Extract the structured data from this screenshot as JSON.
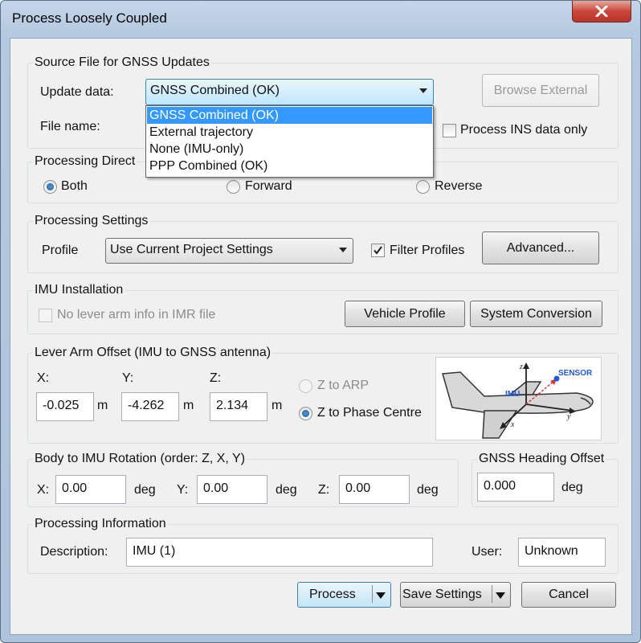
{
  "window": {
    "title": "Process Loosely Coupled"
  },
  "source_file": {
    "legend": "Source File for GNSS Updates",
    "update_data_label": "Update data:",
    "update_data_value": "GNSS Combined (OK)",
    "options": [
      "GNSS Combined (OK)",
      "External trajectory",
      "None (IMU-only)",
      "PPP Combined (OK)"
    ],
    "file_name_label": "File name:",
    "browse_label": "Browse External",
    "ins_only_label": "Process INS data only"
  },
  "direction": {
    "legend": "Processing Direct",
    "both": "Both",
    "forward": "Forward",
    "reverse": "Reverse",
    "selected": "Both"
  },
  "settings": {
    "legend": "Processing Settings",
    "profile_label": "Profile",
    "profile_value": "Use Current Project Settings",
    "filter_label": "Filter Profiles",
    "filter_checked": true,
    "advanced_label": "Advanced..."
  },
  "imu_install": {
    "legend": "IMU Installation",
    "lever_arm_label": "No lever arm info in IMR file",
    "vehicle_profile_label": "Vehicle Profile",
    "system_conversion_label": "System Conversion"
  },
  "lever_arm": {
    "legend": "Lever Arm Offset (IMU to GNSS antenna)",
    "x_label": "X:",
    "x_value": "-0.025",
    "y_label": "Y:",
    "y_value": "-4.262",
    "z_label": "Z:",
    "z_value": "2.134",
    "unit": "m",
    "z_arp_label": "Z to ARP",
    "z_phase_label": "Z to Phase Centre",
    "diagram": {
      "imu": "IMU",
      "sensor": "SENSOR",
      "axis_x": "x",
      "axis_y": "y",
      "axis_z": "z"
    }
  },
  "rotation": {
    "legend": "Body to IMU Rotation (order: Z, X, Y)",
    "x_label": "X:",
    "x_value": "0.00",
    "y_label": "Y:",
    "y_value": "0.00",
    "z_label": "Z:",
    "z_value": "0.00",
    "unit": "deg"
  },
  "heading": {
    "legend": "GNSS Heading Offset",
    "value": "0.000",
    "unit": "deg"
  },
  "info": {
    "legend": "Processing Information",
    "description_label": "Description:",
    "description_value": "IMU (1)",
    "user_label": "User:",
    "user_value": "Unknown"
  },
  "footer": {
    "process_label": "Process",
    "save_label": "Save Settings",
    "cancel_label": "Cancel"
  },
  "colors": {
    "selection": "#3399ff",
    "sensor": "#1f5bd6",
    "arrow": "#d6383a"
  }
}
